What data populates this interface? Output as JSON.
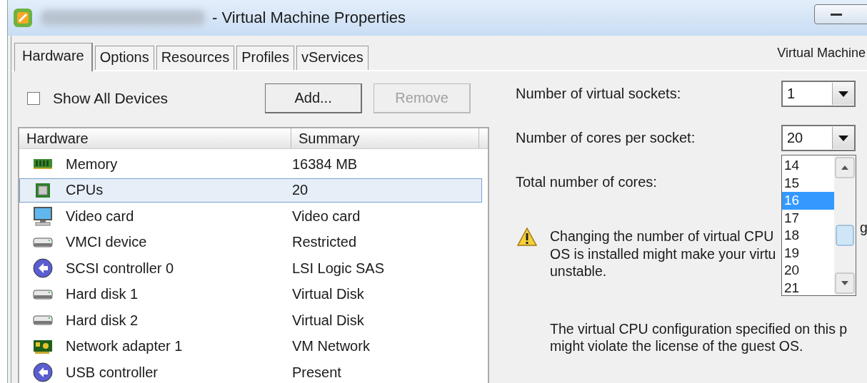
{
  "window": {
    "title": "- Virtual Machine Properties"
  },
  "tabs": [
    {
      "label": "Hardware",
      "selected": true
    },
    {
      "label": "Options",
      "selected": false
    },
    {
      "label": "Resources",
      "selected": false
    },
    {
      "label": "Profiles",
      "selected": false
    },
    {
      "label": "vServices",
      "selected": false
    }
  ],
  "header_right": "Virtual Machine",
  "show_all_devices": {
    "label": "Show All Devices",
    "checked": false
  },
  "buttons": [
    {
      "label": "Add...",
      "disabled": false
    },
    {
      "label": "Remove",
      "disabled": true
    }
  ],
  "table": {
    "columns": [
      "Hardware",
      "Summary"
    ],
    "rows": [
      {
        "kind": "memory",
        "name": "Memory",
        "summary": "16384 MB",
        "selected": false
      },
      {
        "kind": "cpu",
        "name": "CPUs",
        "summary": "20",
        "selected": true
      },
      {
        "kind": "monitor",
        "name": "Video card",
        "summary": "Video card",
        "selected": false
      },
      {
        "kind": "device",
        "name": "VMCI device",
        "summary": "Restricted",
        "selected": false
      },
      {
        "kind": "controller",
        "name": "SCSI controller 0",
        "summary": "LSI Logic SAS",
        "selected": false
      },
      {
        "kind": "device",
        "name": "Hard disk 1",
        "summary": "Virtual Disk",
        "selected": false
      },
      {
        "kind": "device",
        "name": "Hard disk 2",
        "summary": "Virtual Disk",
        "selected": false
      },
      {
        "kind": "nic",
        "name": "Network adapter 1",
        "summary": "VM Network",
        "selected": false
      },
      {
        "kind": "controller",
        "name": "USB controller",
        "summary": "Present",
        "selected": false
      }
    ]
  },
  "settings": [
    {
      "label": "Number of virtual sockets:",
      "value": "1"
    },
    {
      "label": "Number of cores per socket:",
      "value": "20"
    },
    {
      "label": "Total number of cores:"
    }
  ],
  "dropdown": {
    "options": [
      {
        "label": "14",
        "selected": false
      },
      {
        "label": "15",
        "selected": false
      },
      {
        "label": "16",
        "selected": true
      },
      {
        "label": "17",
        "selected": false
      },
      {
        "label": "18",
        "selected": false
      },
      {
        "label": "19",
        "selected": false
      },
      {
        "label": "20",
        "selected": false
      },
      {
        "label": "21",
        "selected": false
      }
    ]
  },
  "warning": {
    "lines": [
      "Changing the number of virtual CPU",
      "OS is installed might make your virtu",
      "unstable."
    ],
    "tail": "g"
  },
  "note": {
    "lines": [
      "The virtual CPU configuration specified on this p",
      "might violate the license of the guest OS."
    ]
  }
}
